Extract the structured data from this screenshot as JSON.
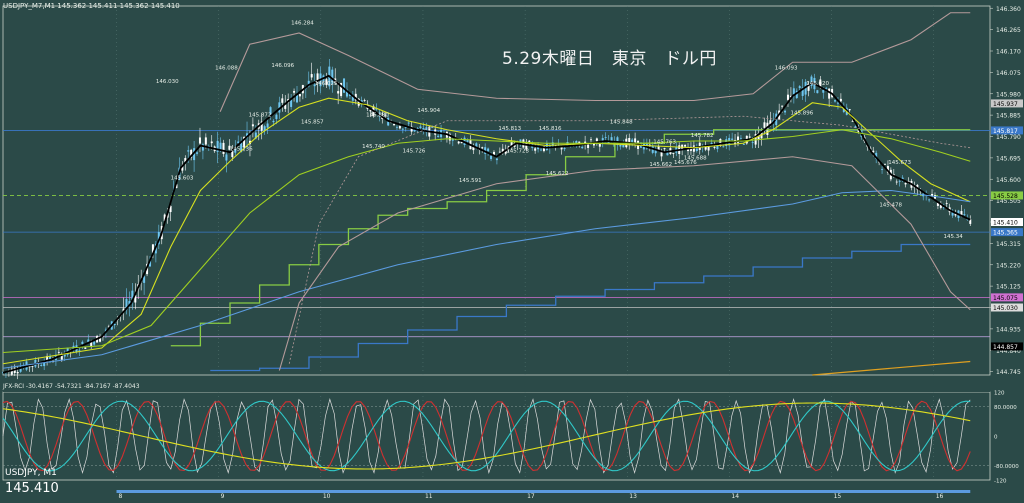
{
  "header": {
    "chart_info": "USDJPY_M7,M1   145.362 145.411 145.362 145.410",
    "indicator_info": "JFX-RCI -30.4167 -54.7321 -84.7167 -87.4043",
    "symbol_label": "USDJPY, M1",
    "current_price": "145.410"
  },
  "chart_data": {
    "type": "line",
    "title": "5.29木曜日　東京　ドル円",
    "ylim": [
      144.73,
      146.37
    ],
    "y_ticks": [
      "146.360",
      "146.265",
      "146.170",
      "146.075",
      "145.980",
      "145.885",
      "145.790",
      "145.695",
      "145.600",
      "145.505",
      "145.410",
      "145.315",
      "145.220",
      "145.125",
      "145.030",
      "144.935",
      "144.840",
      "144.745"
    ],
    "price_tags": [
      {
        "value": 145.937,
        "label": "145.937",
        "bg": "#c9c9c9",
        "fg": "#000000"
      },
      {
        "value": 145.817,
        "label": "145.817",
        "bg": "#3a78c8",
        "fg": "#ffffff"
      },
      {
        "value": 145.528,
        "label": "145.528",
        "bg": "#88cc44",
        "fg": "#000000"
      },
      {
        "value": 145.41,
        "label": "145.410",
        "bg": "#ffffff",
        "fg": "#000000"
      },
      {
        "value": 145.365,
        "label": "145.365",
        "bg": "#3a78c8",
        "fg": "#ffffff"
      },
      {
        "value": 145.075,
        "label": "145.075",
        "bg": "#d070d0",
        "fg": "#000000"
      },
      {
        "value": 145.03,
        "label": "145.030",
        "bg": "#dddddd",
        "fg": "#000000"
      },
      {
        "value": 144.857,
        "label": "144.857",
        "bg": "#000000",
        "fg": "#ffffff"
      }
    ],
    "x_ticks": [
      "8",
      "9",
      "10",
      "11",
      "17",
      "13",
      "14",
      "15",
      "16"
    ],
    "annotations": [
      {
        "text": "146.284",
        "x": 0.302,
        "y": 146.28
      },
      {
        "text": "146.030",
        "x": 0.165,
        "y": 146.02
      },
      {
        "text": "146.088",
        "x": 0.225,
        "y": 146.08
      },
      {
        "text": "146.096",
        "x": 0.282,
        "y": 146.09
      },
      {
        "text": "146.025",
        "x": 0.326,
        "y": 146.01
      },
      {
        "text": "145.872",
        "x": 0.259,
        "y": 145.87
      },
      {
        "text": "145.857",
        "x": 0.312,
        "y": 145.84
      },
      {
        "text": "145.736",
        "x": 0.24,
        "y": 145.72
      },
      {
        "text": "145.603",
        "x": 0.18,
        "y": 145.59
      },
      {
        "text": "145.880",
        "x": 0.378,
        "y": 145.87
      },
      {
        "text": "145.904",
        "x": 0.43,
        "y": 145.89
      },
      {
        "text": "145.740",
        "x": 0.374,
        "y": 145.73
      },
      {
        "text": "145.726",
        "x": 0.415,
        "y": 145.71
      },
      {
        "text": "145.813",
        "x": 0.512,
        "y": 145.81
      },
      {
        "text": "145.816",
        "x": 0.553,
        "y": 145.81
      },
      {
        "text": "145.848",
        "x": 0.625,
        "y": 145.84
      },
      {
        "text": "145.782",
        "x": 0.707,
        "y": 145.78
      },
      {
        "text": "145.723",
        "x": 0.52,
        "y": 145.71
      },
      {
        "text": "145.763",
        "x": 0.669,
        "y": 145.75
      },
      {
        "text": "145.688",
        "x": 0.7,
        "y": 145.68
      },
      {
        "text": "145.662",
        "x": 0.665,
        "y": 145.65
      },
      {
        "text": "145.676",
        "x": 0.69,
        "y": 145.66
      },
      {
        "text": "145.622",
        "x": 0.56,
        "y": 145.61
      },
      {
        "text": "145.591",
        "x": 0.472,
        "y": 145.58
      },
      {
        "text": "146.093",
        "x": 0.792,
        "y": 146.08
      },
      {
        "text": "146.020",
        "x": 0.824,
        "y": 146.01
      },
      {
        "text": "145.896",
        "x": 0.808,
        "y": 145.88
      },
      {
        "text": "145.673",
        "x": 0.907,
        "y": 145.66
      },
      {
        "text": "145.478",
        "x": 0.898,
        "y": 145.47
      },
      {
        "text": "145.34",
        "x": 0.963,
        "y": 145.33
      }
    ],
    "series": [
      {
        "color": "#000000",
        "values": [
          [
            0,
            144.74
          ],
          [
            0.05,
            144.8
          ],
          [
            0.1,
            144.9
          ],
          [
            0.13,
            145.05
          ],
          [
            0.16,
            145.35
          ],
          [
            0.18,
            145.65
          ],
          [
            0.2,
            145.75
          ],
          [
            0.23,
            145.72
          ],
          [
            0.26,
            145.84
          ],
          [
            0.29,
            145.95
          ],
          [
            0.31,
            146.02
          ],
          [
            0.33,
            146.06
          ],
          [
            0.36,
            145.95
          ],
          [
            0.39,
            145.86
          ],
          [
            0.42,
            145.82
          ],
          [
            0.45,
            145.8
          ],
          [
            0.48,
            145.74
          ],
          [
            0.5,
            145.7
          ],
          [
            0.52,
            145.76
          ],
          [
            0.55,
            145.74
          ],
          [
            0.58,
            145.75
          ],
          [
            0.61,
            145.77
          ],
          [
            0.64,
            145.76
          ],
          [
            0.67,
            145.72
          ],
          [
            0.7,
            145.74
          ],
          [
            0.73,
            145.76
          ],
          [
            0.76,
            145.78
          ],
          [
            0.78,
            145.85
          ],
          [
            0.8,
            145.97
          ],
          [
            0.82,
            146.03
          ],
          [
            0.84,
            145.98
          ],
          [
            0.86,
            145.88
          ],
          [
            0.88,
            145.72
          ],
          [
            0.9,
            145.62
          ],
          [
            0.92,
            145.58
          ],
          [
            0.94,
            145.52
          ],
          [
            0.96,
            145.46
          ],
          [
            0.98,
            145.42
          ]
        ]
      },
      {
        "color": "#d6e020",
        "values": [
          [
            0,
            144.78
          ],
          [
            0.1,
            144.85
          ],
          [
            0.14,
            145.0
          ],
          [
            0.17,
            145.3
          ],
          [
            0.2,
            145.55
          ],
          [
            0.23,
            145.68
          ],
          [
            0.26,
            145.8
          ],
          [
            0.3,
            145.92
          ],
          [
            0.33,
            145.96
          ],
          [
            0.37,
            145.93
          ],
          [
            0.41,
            145.86
          ],
          [
            0.45,
            145.82
          ],
          [
            0.5,
            145.78
          ],
          [
            0.55,
            145.75
          ],
          [
            0.6,
            145.76
          ],
          [
            0.65,
            145.75
          ],
          [
            0.7,
            145.74
          ],
          [
            0.75,
            145.76
          ],
          [
            0.78,
            145.82
          ],
          [
            0.82,
            145.94
          ],
          [
            0.85,
            145.92
          ],
          [
            0.88,
            145.8
          ],
          [
            0.91,
            145.68
          ],
          [
            0.94,
            145.58
          ],
          [
            0.97,
            145.52
          ],
          [
            0.98,
            145.5
          ]
        ]
      },
      {
        "color": "#a0d020",
        "values": [
          [
            0,
            144.83
          ],
          [
            0.1,
            144.86
          ],
          [
            0.15,
            144.95
          ],
          [
            0.2,
            145.2
          ],
          [
            0.25,
            145.45
          ],
          [
            0.3,
            145.62
          ],
          [
            0.35,
            145.7
          ],
          [
            0.4,
            145.76
          ],
          [
            0.45,
            145.78
          ],
          [
            0.5,
            145.77
          ],
          [
            0.55,
            145.76
          ],
          [
            0.6,
            145.76
          ],
          [
            0.65,
            145.76
          ],
          [
            0.7,
            145.77
          ],
          [
            0.75,
            145.77
          ],
          [
            0.8,
            145.79
          ],
          [
            0.85,
            145.82
          ],
          [
            0.9,
            145.78
          ],
          [
            0.95,
            145.72
          ],
          [
            0.98,
            145.68
          ]
        ]
      },
      {
        "color": "#5b9be0",
        "values": [
          [
            0,
            144.76
          ],
          [
            0.1,
            144.82
          ],
          [
            0.2,
            144.95
          ],
          [
            0.3,
            145.1
          ],
          [
            0.4,
            145.22
          ],
          [
            0.5,
            145.31
          ],
          [
            0.6,
            145.38
          ],
          [
            0.7,
            145.43
          ],
          [
            0.8,
            145.49
          ],
          [
            0.85,
            145.54
          ],
          [
            0.9,
            145.55
          ],
          [
            0.95,
            145.52
          ],
          [
            0.98,
            145.5
          ]
        ]
      },
      {
        "color": "#b49a9a",
        "values": [
          [
            0.28,
            144.75
          ],
          [
            0.3,
            145.05
          ],
          [
            0.34,
            145.3
          ],
          [
            0.4,
            145.45
          ],
          [
            0.5,
            145.58
          ],
          [
            0.6,
            145.64
          ],
          [
            0.7,
            145.66
          ],
          [
            0.8,
            145.7
          ],
          [
            0.86,
            145.66
          ],
          [
            0.92,
            145.4
          ],
          [
            0.96,
            145.1
          ],
          [
            0.98,
            145.02
          ]
        ]
      },
      {
        "color": "#b49a9a",
        "values": [
          [
            0.22,
            145.9
          ],
          [
            0.25,
            146.2
          ],
          [
            0.3,
            146.25
          ],
          [
            0.35,
            146.15
          ],
          [
            0.42,
            146.0
          ],
          [
            0.5,
            145.96
          ],
          [
            0.6,
            145.95
          ],
          [
            0.7,
            145.95
          ],
          [
            0.76,
            145.98
          ],
          [
            0.8,
            146.12
          ],
          [
            0.86,
            146.12
          ],
          [
            0.92,
            146.22
          ],
          [
            0.96,
            146.34
          ],
          [
            0.98,
            146.34
          ]
        ]
      }
    ],
    "steps": [
      {
        "color": "#88cc44",
        "values": [
          [
            0.17,
            144.86
          ],
          [
            0.2,
            144.96
          ],
          [
            0.23,
            145.05
          ],
          [
            0.26,
            145.13
          ],
          [
            0.29,
            145.22
          ],
          [
            0.32,
            145.31
          ],
          [
            0.35,
            145.38
          ],
          [
            0.38,
            145.44
          ],
          [
            0.41,
            145.47
          ],
          [
            0.45,
            145.5
          ],
          [
            0.49,
            145.55
          ],
          [
            0.53,
            145.62
          ],
          [
            0.57,
            145.7
          ],
          [
            0.62,
            145.76
          ],
          [
            0.67,
            145.8
          ],
          [
            0.72,
            145.82
          ],
          [
            0.78,
            145.82
          ],
          [
            0.98,
            145.82
          ]
        ]
      },
      {
        "color": "#3a78c8",
        "values": [
          [
            0.21,
            144.75
          ],
          [
            0.26,
            144.76
          ],
          [
            0.31,
            144.81
          ],
          [
            0.36,
            144.87
          ],
          [
            0.41,
            144.93
          ],
          [
            0.46,
            144.99
          ],
          [
            0.51,
            145.04
          ],
          [
            0.56,
            145.08
          ],
          [
            0.61,
            145.11
          ],
          [
            0.66,
            145.14
          ],
          [
            0.71,
            145.17
          ],
          [
            0.76,
            145.21
          ],
          [
            0.81,
            145.25
          ],
          [
            0.86,
            145.28
          ],
          [
            0.91,
            145.31
          ],
          [
            0.98,
            145.31
          ]
        ]
      }
    ],
    "h_lines": [
      {
        "value": 145.817,
        "color": "#3a78c8",
        "dash": ""
      },
      {
        "value": 145.528,
        "color": "#88cc44",
        "dash": "4,3"
      },
      {
        "value": 145.365,
        "color": "#3a78c8",
        "dash": ""
      },
      {
        "value": 145.075,
        "color": "#d070d0",
        "dash": ""
      },
      {
        "value": 145.03,
        "color": "#c0c0c0",
        "dash": ""
      },
      {
        "value": 144.9,
        "color": "#c8a8e8",
        "dash": ""
      }
    ],
    "grid": true,
    "subchart": {
      "type": "line",
      "ylim": [
        -120,
        120
      ],
      "y_ticks": [
        "120",
        "80.0000",
        "0",
        "-80.0000",
        "-120"
      ],
      "series_colors": [
        "#dddddd",
        "#d03030",
        "#30c8c8",
        "#e0e020"
      ]
    }
  }
}
